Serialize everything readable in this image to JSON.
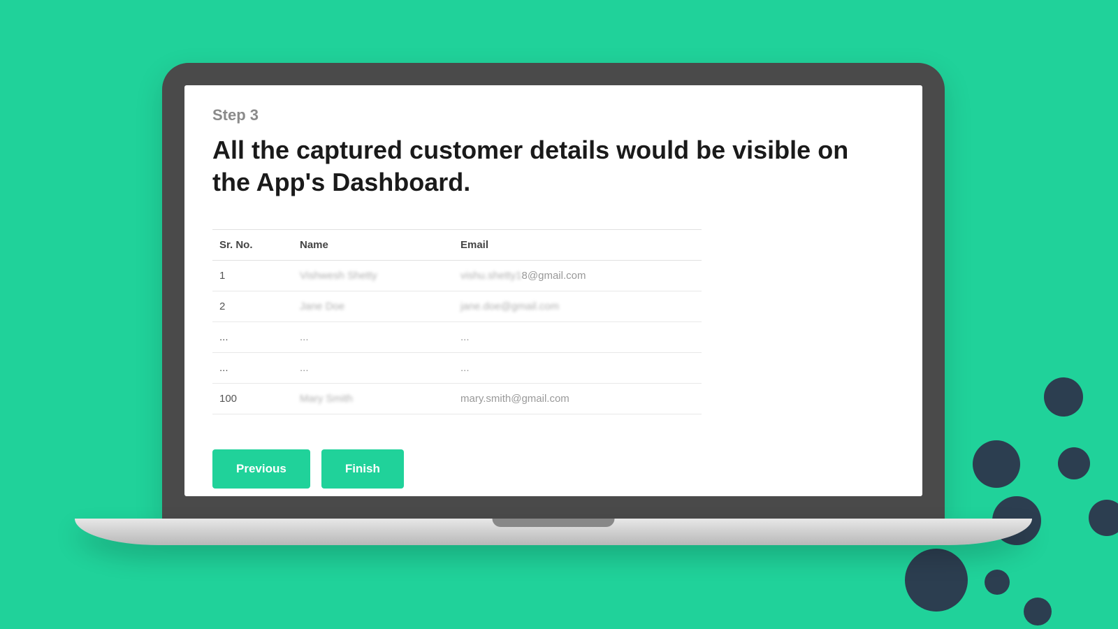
{
  "step_label": "Step 3",
  "heading": "All the captured customer details would be visible on the App's Dashboard.",
  "table": {
    "headers": [
      "Sr. No.",
      "Name",
      "Email"
    ],
    "rows": [
      {
        "sr": "1",
        "name": "Vishwesh Shetty",
        "email_blur": "vishu.shetty1",
        "email_clear": "8@gmail.com",
        "blurred": "partial"
      },
      {
        "sr": "2",
        "name": "Jane Doe",
        "email": "jane.doe@gmail.com",
        "blurred": "full"
      },
      {
        "sr": "...",
        "name": "...",
        "email": "...",
        "blurred": "none"
      },
      {
        "sr": "...",
        "name": "...",
        "email": "...",
        "blurred": "none"
      },
      {
        "sr": "100",
        "name": "Mary Smith",
        "email": "mary.smith@gmail.com",
        "blurred": "name-only"
      }
    ]
  },
  "buttons": {
    "previous": "Previous",
    "finish": "Finish"
  },
  "colors": {
    "brand": "#20d29a",
    "dot": "#2c3e50"
  }
}
